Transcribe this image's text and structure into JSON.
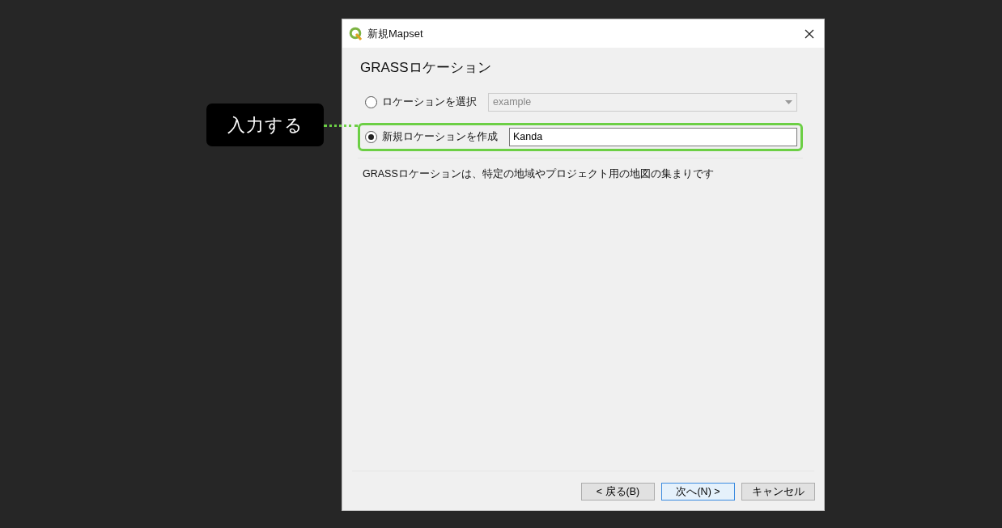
{
  "callout": {
    "text": "入力する"
  },
  "window": {
    "title": "新規Mapset"
  },
  "page_title": "GRASSロケーション",
  "options": [
    {
      "kind": "select",
      "label": "ロケーションを選択",
      "selected": false,
      "value": "example",
      "disabled": true,
      "highlighted": false
    },
    {
      "kind": "text",
      "label": "新規ロケーションを作成",
      "selected": true,
      "value": "Kanda",
      "disabled": false,
      "highlighted": true
    }
  ],
  "description": "GRASSロケーションは、特定の地域やプロジェクト用の地図の集まりです",
  "buttons": [
    {
      "label": "< 戻る(B)",
      "default": false
    },
    {
      "label": "次へ(N) >",
      "default": true
    },
    {
      "label": "キャンセル",
      "default": false
    }
  ]
}
